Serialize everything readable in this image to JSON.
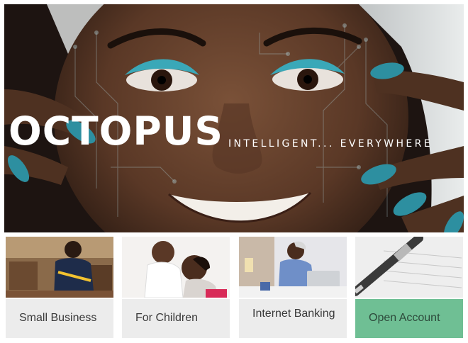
{
  "hero": {
    "brand": "OCTOPUS",
    "tagline": "INTELLIGENT... EVERYWHERE",
    "colors": {
      "nail_accent": "#2d8fa0",
      "eyeshadow": "#3aa8b8",
      "skin": "#6b4632"
    }
  },
  "cards": [
    {
      "label": "Small Business",
      "photo": "worker-in-workshop"
    },
    {
      "label": "For Children",
      "photo": "mother-and-baby"
    },
    {
      "label": "Internet Banking",
      "photo": "woman-at-laptop"
    },
    {
      "label": "Open Account",
      "photo": "pen-on-document",
      "accent": "#6fbf94"
    }
  ]
}
